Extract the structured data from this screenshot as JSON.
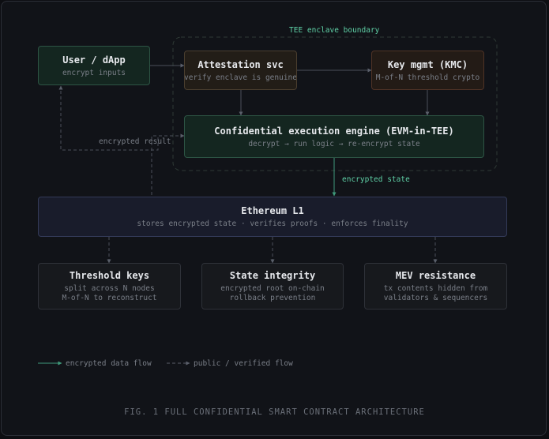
{
  "enclave": {
    "label": "TEE enclave boundary"
  },
  "nodes": {
    "user": {
      "title": "User / dApp",
      "sub": "encrypt inputs"
    },
    "attestation": {
      "title": "Attestation svc",
      "sub": "verify enclave is genuine"
    },
    "kms": {
      "title": "Key mgmt (KMC)",
      "sub": "M-of-N threshold crypto"
    },
    "engine": {
      "title": "Confidential execution engine (EVM-in-TEE)",
      "sub": "decrypt → run logic → re-encrypt state"
    },
    "ethereum": {
      "title": "Ethereum L1",
      "sub": "stores encrypted state · verifies proofs · enforces finality"
    },
    "threshold": {
      "title": "Threshold keys",
      "sub1": "split across N nodes",
      "sub2": "M-of-N to reconstruct"
    },
    "integrity": {
      "title": "State integrity",
      "sub1": "encrypted root on-chain",
      "sub2": "rollback prevention"
    },
    "mev": {
      "title": "MEV resistance",
      "sub1": "tx contents hidden from",
      "sub2": "validators & sequencers"
    }
  },
  "edges": {
    "encrypted_result": "encrypted result",
    "encrypted_state": "encrypted state"
  },
  "legend": {
    "encrypted": "encrypted data flow",
    "public": "public / verified flow"
  },
  "caption": "FIG. 1 FULL CONFIDENTIAL SMART CONTRACT ARCHITECTURE",
  "colors": {
    "encrypted_flow": "#3f9a7b",
    "public_flow": "#4a4f5a",
    "accent": "#5fd0a6"
  }
}
